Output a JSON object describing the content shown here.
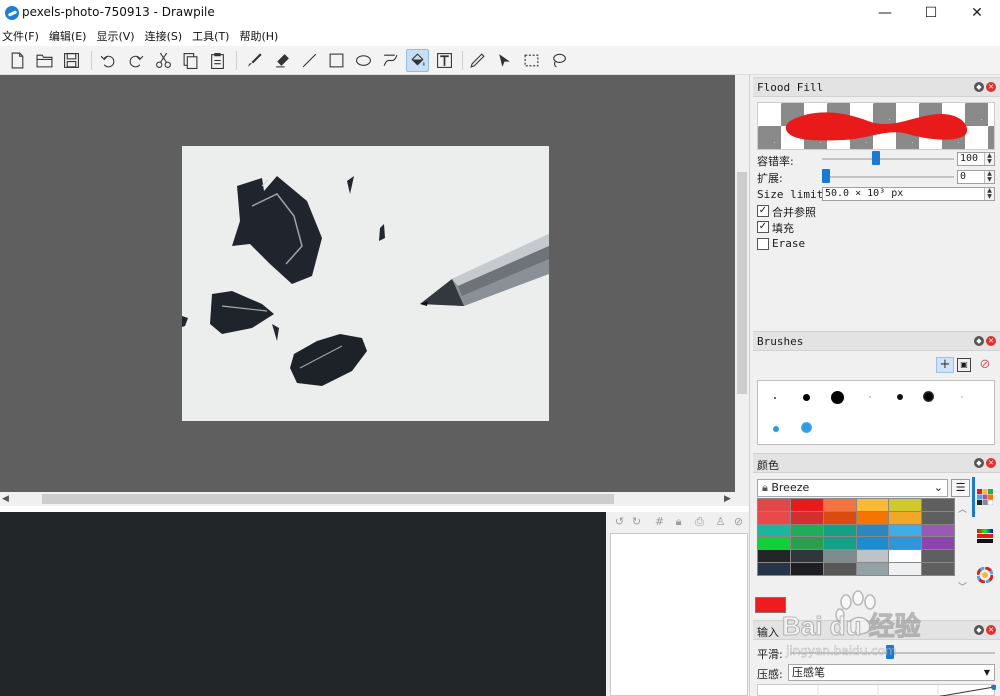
{
  "window": {
    "title": "pexels-photo-750913 - Drawpile",
    "minimize_glyph": "—",
    "maximize_glyph": "☐",
    "close_glyph": "✕"
  },
  "menu": [
    "文件(F)",
    "编辑(E)",
    "显示(V)",
    "连接(S)",
    "工具(T)",
    "帮助(H)"
  ],
  "toolbar": {
    "buttons": [
      "new-icon",
      "open-icon",
      "save-icon",
      "undo-icon",
      "redo-icon",
      "cut-icon",
      "copy-icon",
      "paste-icon",
      "brush-icon",
      "eraser-icon",
      "line-icon",
      "rectangle-icon",
      "ellipse-icon",
      "bezier-icon",
      "flood-fill-icon",
      "text-icon",
      "color-picker-icon",
      "selection-arrow-icon",
      "rect-select-icon",
      "lasso-icon"
    ],
    "active": "flood-fill-icon"
  },
  "flood_fill": {
    "title": "Flood Fill",
    "tolerance_label": "容错率:",
    "tolerance_value": "100",
    "tolerance_fraction": 0.4,
    "expand_label": "扩展:",
    "expand_value": "0",
    "expand_fraction": 0.0,
    "size_limit_label": "Size limit:",
    "size_limit_value": "50.0 × 10³ px",
    "merge_label": "合并参照",
    "merge_checked": true,
    "fill_label": "填充",
    "fill_checked": true,
    "erase_label": "Erase",
    "erase_checked": false,
    "preview_color": "#e81a1a"
  },
  "brushes": {
    "title": "Brushes",
    "add_icon": "plus-icon",
    "save_icon": "save-icon",
    "delete_icon": "forbidden-icon"
  },
  "colors": {
    "title": "颜色",
    "palette_name": "Breeze",
    "current_color": "#ee1c1c",
    "swatches": [
      "#e2474a",
      "#e81b1b",
      "#f47342",
      "#fcb936",
      "#ceca2d",
      "#5f5f5f",
      "#e84a4c",
      "#d32f2f",
      "#da4b10",
      "#f67400",
      "#f3a727",
      "#5f5f5f",
      "#1bb69e",
      "#1dae57",
      "#14a085",
      "#2c87c1",
      "#3daee9",
      "#9b59b6",
      "#11d13a",
      "#2b9d4c",
      "#16a086",
      "#1d8ccf",
      "#2e96d9",
      "#8e44ad",
      "#232629",
      "#31363b",
      "#7f8c8d",
      "#bdc3c7",
      "#ffffff",
      "#5f5f5f",
      "#263547",
      "#1d1f22",
      "#575757",
      "#94a1a6",
      "#eff0f1",
      "#5f5f5f"
    ]
  },
  "input": {
    "title": "输入",
    "smoothing_label": "平滑:",
    "pressure_label": "压感:",
    "pressure_value": "压感笔"
  },
  "watermark": {
    "brand": "Bai du 经验",
    "url": "jingyan.baidu.com"
  }
}
